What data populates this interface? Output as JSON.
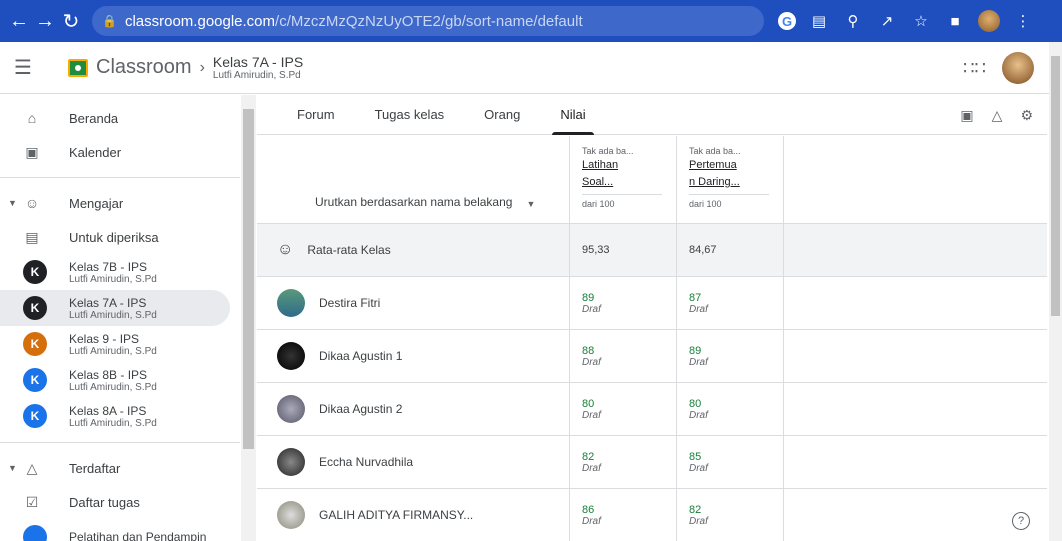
{
  "browser": {
    "url_host": "classroom.google.com",
    "url_path": "/c/MzczMzQzNzUyOTE2/gb/sort-name/default"
  },
  "header": {
    "brand": "Classroom",
    "class_name": "Kelas 7A - IPS",
    "class_owner": "Lutfi Amirudin, S.Pd"
  },
  "sidebar": {
    "home": "Beranda",
    "calendar": "Kalender",
    "teaching": "Mengajar",
    "to_review": "Untuk diperiksa",
    "classes": [
      {
        "initial": "K",
        "name": "Kelas 7B - IPS",
        "owner": "Lutfi Amirudin, S.Pd",
        "color": "#202124"
      },
      {
        "initial": "K",
        "name": "Kelas 7A - IPS",
        "owner": "Lutfi Amirudin, S.Pd",
        "color": "#202124"
      },
      {
        "initial": "K",
        "name": "Kelas 9 - IPS",
        "owner": "Lutfi Amirudin, S.Pd",
        "color": "#d56e0c"
      },
      {
        "initial": "K",
        "name": "Kelas 8B - IPS",
        "owner": "Lutfi Amirudin, S.Pd",
        "color": "#1a73e8"
      },
      {
        "initial": "K",
        "name": "Kelas 8A - IPS",
        "owner": "Lutfi Amirudin, S.Pd",
        "color": "#1a73e8"
      }
    ],
    "enrolled": "Terdaftar",
    "todo": "Daftar tugas",
    "partial": "Pelatihan dan Pendampin"
  },
  "tabs": [
    "Forum",
    "Tugas kelas",
    "Orang",
    "Nilai"
  ],
  "grid": {
    "sort_label": "Urutkan berdasarkan nama belakang",
    "columns": [
      {
        "status": "Tak ada ba...",
        "title_1": "Latihan",
        "title_2": "Soal...",
        "max": "dari 100"
      },
      {
        "status": "Tak ada ba...",
        "title_1": "Pertemua",
        "title_2": "n Daring...",
        "max": "dari 100"
      }
    ],
    "average": {
      "label": "Rata-rata Kelas",
      "values": [
        "95,33",
        "84,67"
      ]
    },
    "students": [
      {
        "name": "Destira Fitri",
        "scores": [
          "89",
          "87"
        ],
        "status": "Draf"
      },
      {
        "name": "Dikaa Agustin 1",
        "scores": [
          "88",
          "89"
        ],
        "status": "Draf"
      },
      {
        "name": "Dikaa Agustin 2",
        "scores": [
          "80",
          "80"
        ],
        "status": "Draf"
      },
      {
        "name": "Eccha Nurvadhila",
        "scores": [
          "82",
          "85"
        ],
        "status": "Draf"
      },
      {
        "name": "GALIH ADITYA FIRMANSY...",
        "scores": [
          "86",
          "82"
        ],
        "status": "Draf"
      }
    ]
  }
}
